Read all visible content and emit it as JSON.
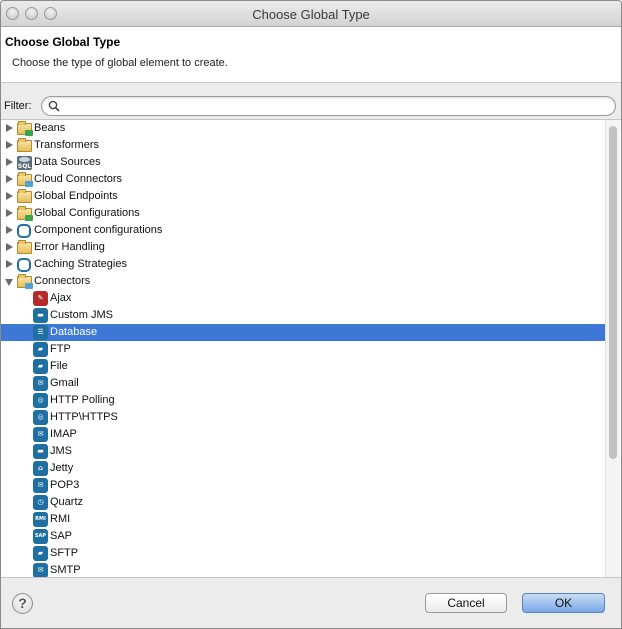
{
  "window": {
    "title": "Choose Global Type"
  },
  "header": {
    "title": "Choose Global Type",
    "description": "Choose the type of global element to create."
  },
  "filter": {
    "label": "Filter:",
    "value": "",
    "placeholder": ""
  },
  "tree": {
    "categories": [
      {
        "label": "Beans",
        "expanded": false,
        "icon": "folder-icon"
      },
      {
        "label": "Transformers",
        "expanded": false,
        "icon": "folder-icon"
      },
      {
        "label": "Data Sources",
        "expanded": false,
        "icon": "sql-database-icon"
      },
      {
        "label": "Cloud Connectors",
        "expanded": false,
        "icon": "folder-icon"
      },
      {
        "label": "Global Endpoints",
        "expanded": false,
        "icon": "folder-icon"
      },
      {
        "label": "Global Configurations",
        "expanded": false,
        "icon": "folder-icon"
      },
      {
        "label": "Component configurations",
        "expanded": false,
        "icon": "component-icon"
      },
      {
        "label": "Error Handling",
        "expanded": false,
        "icon": "folder-icon"
      },
      {
        "label": "Caching Strategies",
        "expanded": false,
        "icon": "component-icon"
      },
      {
        "label": "Connectors",
        "expanded": true,
        "icon": "folder-icon"
      }
    ],
    "connectors": [
      {
        "label": "Ajax",
        "icon": "ajax-icon"
      },
      {
        "label": "Custom JMS",
        "icon": "jms-icon"
      },
      {
        "label": "Database",
        "icon": "database-icon"
      },
      {
        "label": "FTP",
        "icon": "ftp-folder-icon"
      },
      {
        "label": "File",
        "icon": "file-folder-icon"
      },
      {
        "label": "Gmail",
        "icon": "mail-icon"
      },
      {
        "label": "HTTP Polling",
        "icon": "globe-icon"
      },
      {
        "label": "HTTP\\HTTPS",
        "icon": "globe-icon"
      },
      {
        "label": "IMAP",
        "icon": "mail-icon"
      },
      {
        "label": "JMS",
        "icon": "jms-icon"
      },
      {
        "label": "Jetty",
        "icon": "jetty-icon"
      },
      {
        "label": "POP3",
        "icon": "mail-icon"
      },
      {
        "label": "Quartz",
        "icon": "clock-icon"
      },
      {
        "label": "RMI",
        "icon": "rmi-icon"
      },
      {
        "label": "SAP",
        "icon": "sap-icon"
      },
      {
        "label": "SFTP",
        "icon": "sftp-folder-icon"
      },
      {
        "label": "SMTP",
        "icon": "mail-icon"
      }
    ],
    "selected": "Database"
  },
  "icon_glyphs": {
    "sap": "SAP",
    "rmi": "RMI"
  },
  "buttons": {
    "help": "?",
    "cancel": "Cancel",
    "ok": "OK"
  },
  "colors": {
    "selection": "#3d78d7",
    "connector_icon": "#1f6fa3",
    "ok_button": "#79a8e6"
  }
}
